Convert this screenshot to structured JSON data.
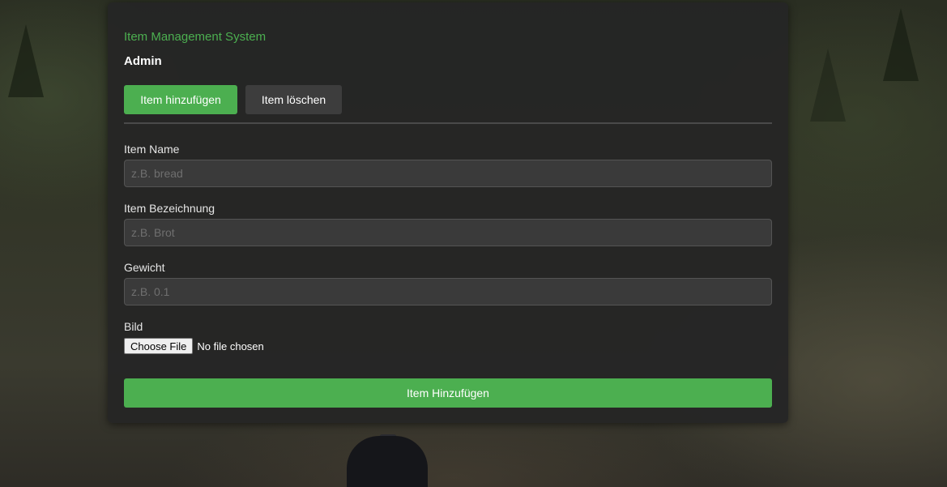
{
  "app": {
    "title": "Item Management System",
    "role": "Admin"
  },
  "tabs": [
    {
      "label": "Item hinzufügen",
      "active": true
    },
    {
      "label": "Item löschen",
      "active": false
    }
  ],
  "form": {
    "name": {
      "label": "Item Name",
      "placeholder": "z.B. bread",
      "value": ""
    },
    "description": {
      "label": "Item Bezeichnung",
      "placeholder": "z.B. Brot",
      "value": ""
    },
    "weight": {
      "label": "Gewicht",
      "placeholder": "z.B. 0.1",
      "value": ""
    },
    "image": {
      "label": "Bild",
      "button_label": "Choose File",
      "status": "No file chosen"
    },
    "submit_label": "Item Hinzufügen"
  },
  "colors": {
    "accent": "#4caf50",
    "panel": "#252525",
    "input_bg": "#3a3a3a",
    "tab_inactive": "#3d3d3d"
  }
}
